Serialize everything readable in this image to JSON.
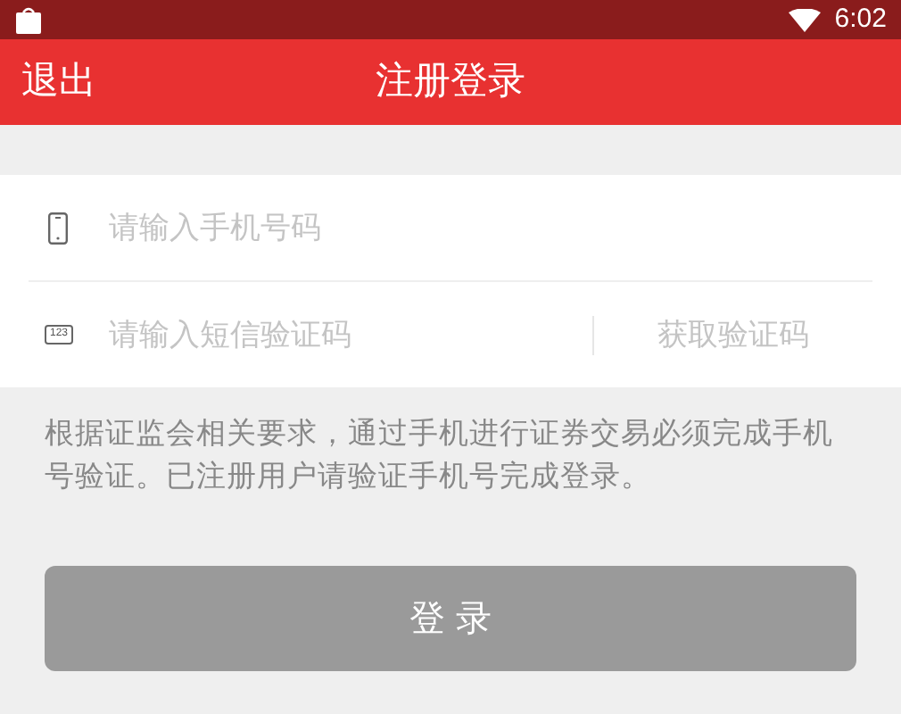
{
  "status_bar": {
    "time": "6:02"
  },
  "header": {
    "back": "退出",
    "title": "注册登录"
  },
  "form": {
    "phone": {
      "placeholder": "请输入手机号码"
    },
    "code": {
      "placeholder": "请输入短信验证码",
      "icon_label": "123",
      "action": "获取验证码",
      "action_disabled": true
    }
  },
  "notice": "根据证监会相关要求，通过手机进行证券交易必须完成手机号验证。已注册用户请验证手机号完成登录。",
  "login_button": {
    "label": "登 录",
    "disabled": true
  }
}
